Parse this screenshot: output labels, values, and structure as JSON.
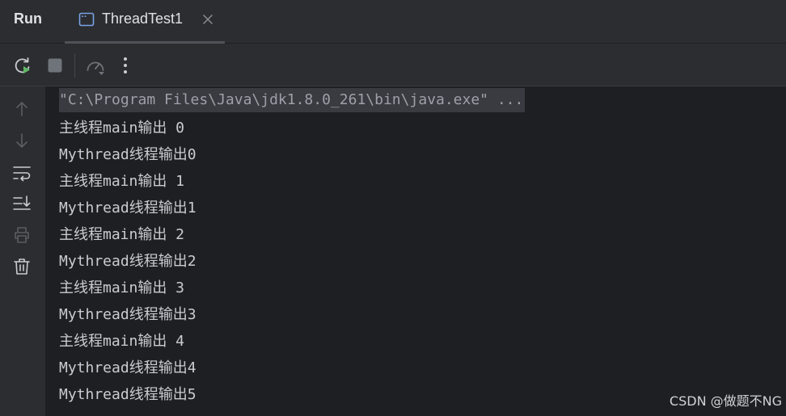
{
  "header": {
    "title": "Run",
    "tab": {
      "label": "ThreadTest1",
      "icon": "console-window-icon",
      "close_icon": "close-icon"
    }
  },
  "toolbar": {
    "buttons": [
      {
        "name": "rerun-icon"
      },
      {
        "name": "stop-icon"
      },
      {
        "name": "profiler-gauge-icon"
      },
      {
        "name": "more-options-icon"
      }
    ]
  },
  "gutter": {
    "buttons": [
      {
        "name": "scroll-up-icon"
      },
      {
        "name": "scroll-down-icon"
      },
      {
        "name": "soft-wrap-icon"
      },
      {
        "name": "scroll-to-end-icon"
      },
      {
        "name": "print-icon"
      },
      {
        "name": "clear-all-icon"
      }
    ]
  },
  "console": {
    "command": "\"C:\\Program Files\\Java\\jdk1.8.0_261\\bin\\java.exe\" ...",
    "lines": [
      "主线程main输出 0",
      "Mythread线程输出0",
      "主线程main输出 1",
      "Mythread线程输出1",
      "主线程main输出 2",
      "Mythread线程输出2",
      "主线程main输出 3",
      "Mythread线程输出3",
      "主线程main输出 4",
      "Mythread线程输出4",
      "Mythread线程输出5"
    ]
  },
  "watermark": "CSDN @做题不NG",
  "colors": {
    "panel_bg": "#2b2d30",
    "console_bg": "#1e1f22",
    "text": "#c9ccd2",
    "accent_green": "#5fb865",
    "icon_muted": "#6f737a"
  }
}
